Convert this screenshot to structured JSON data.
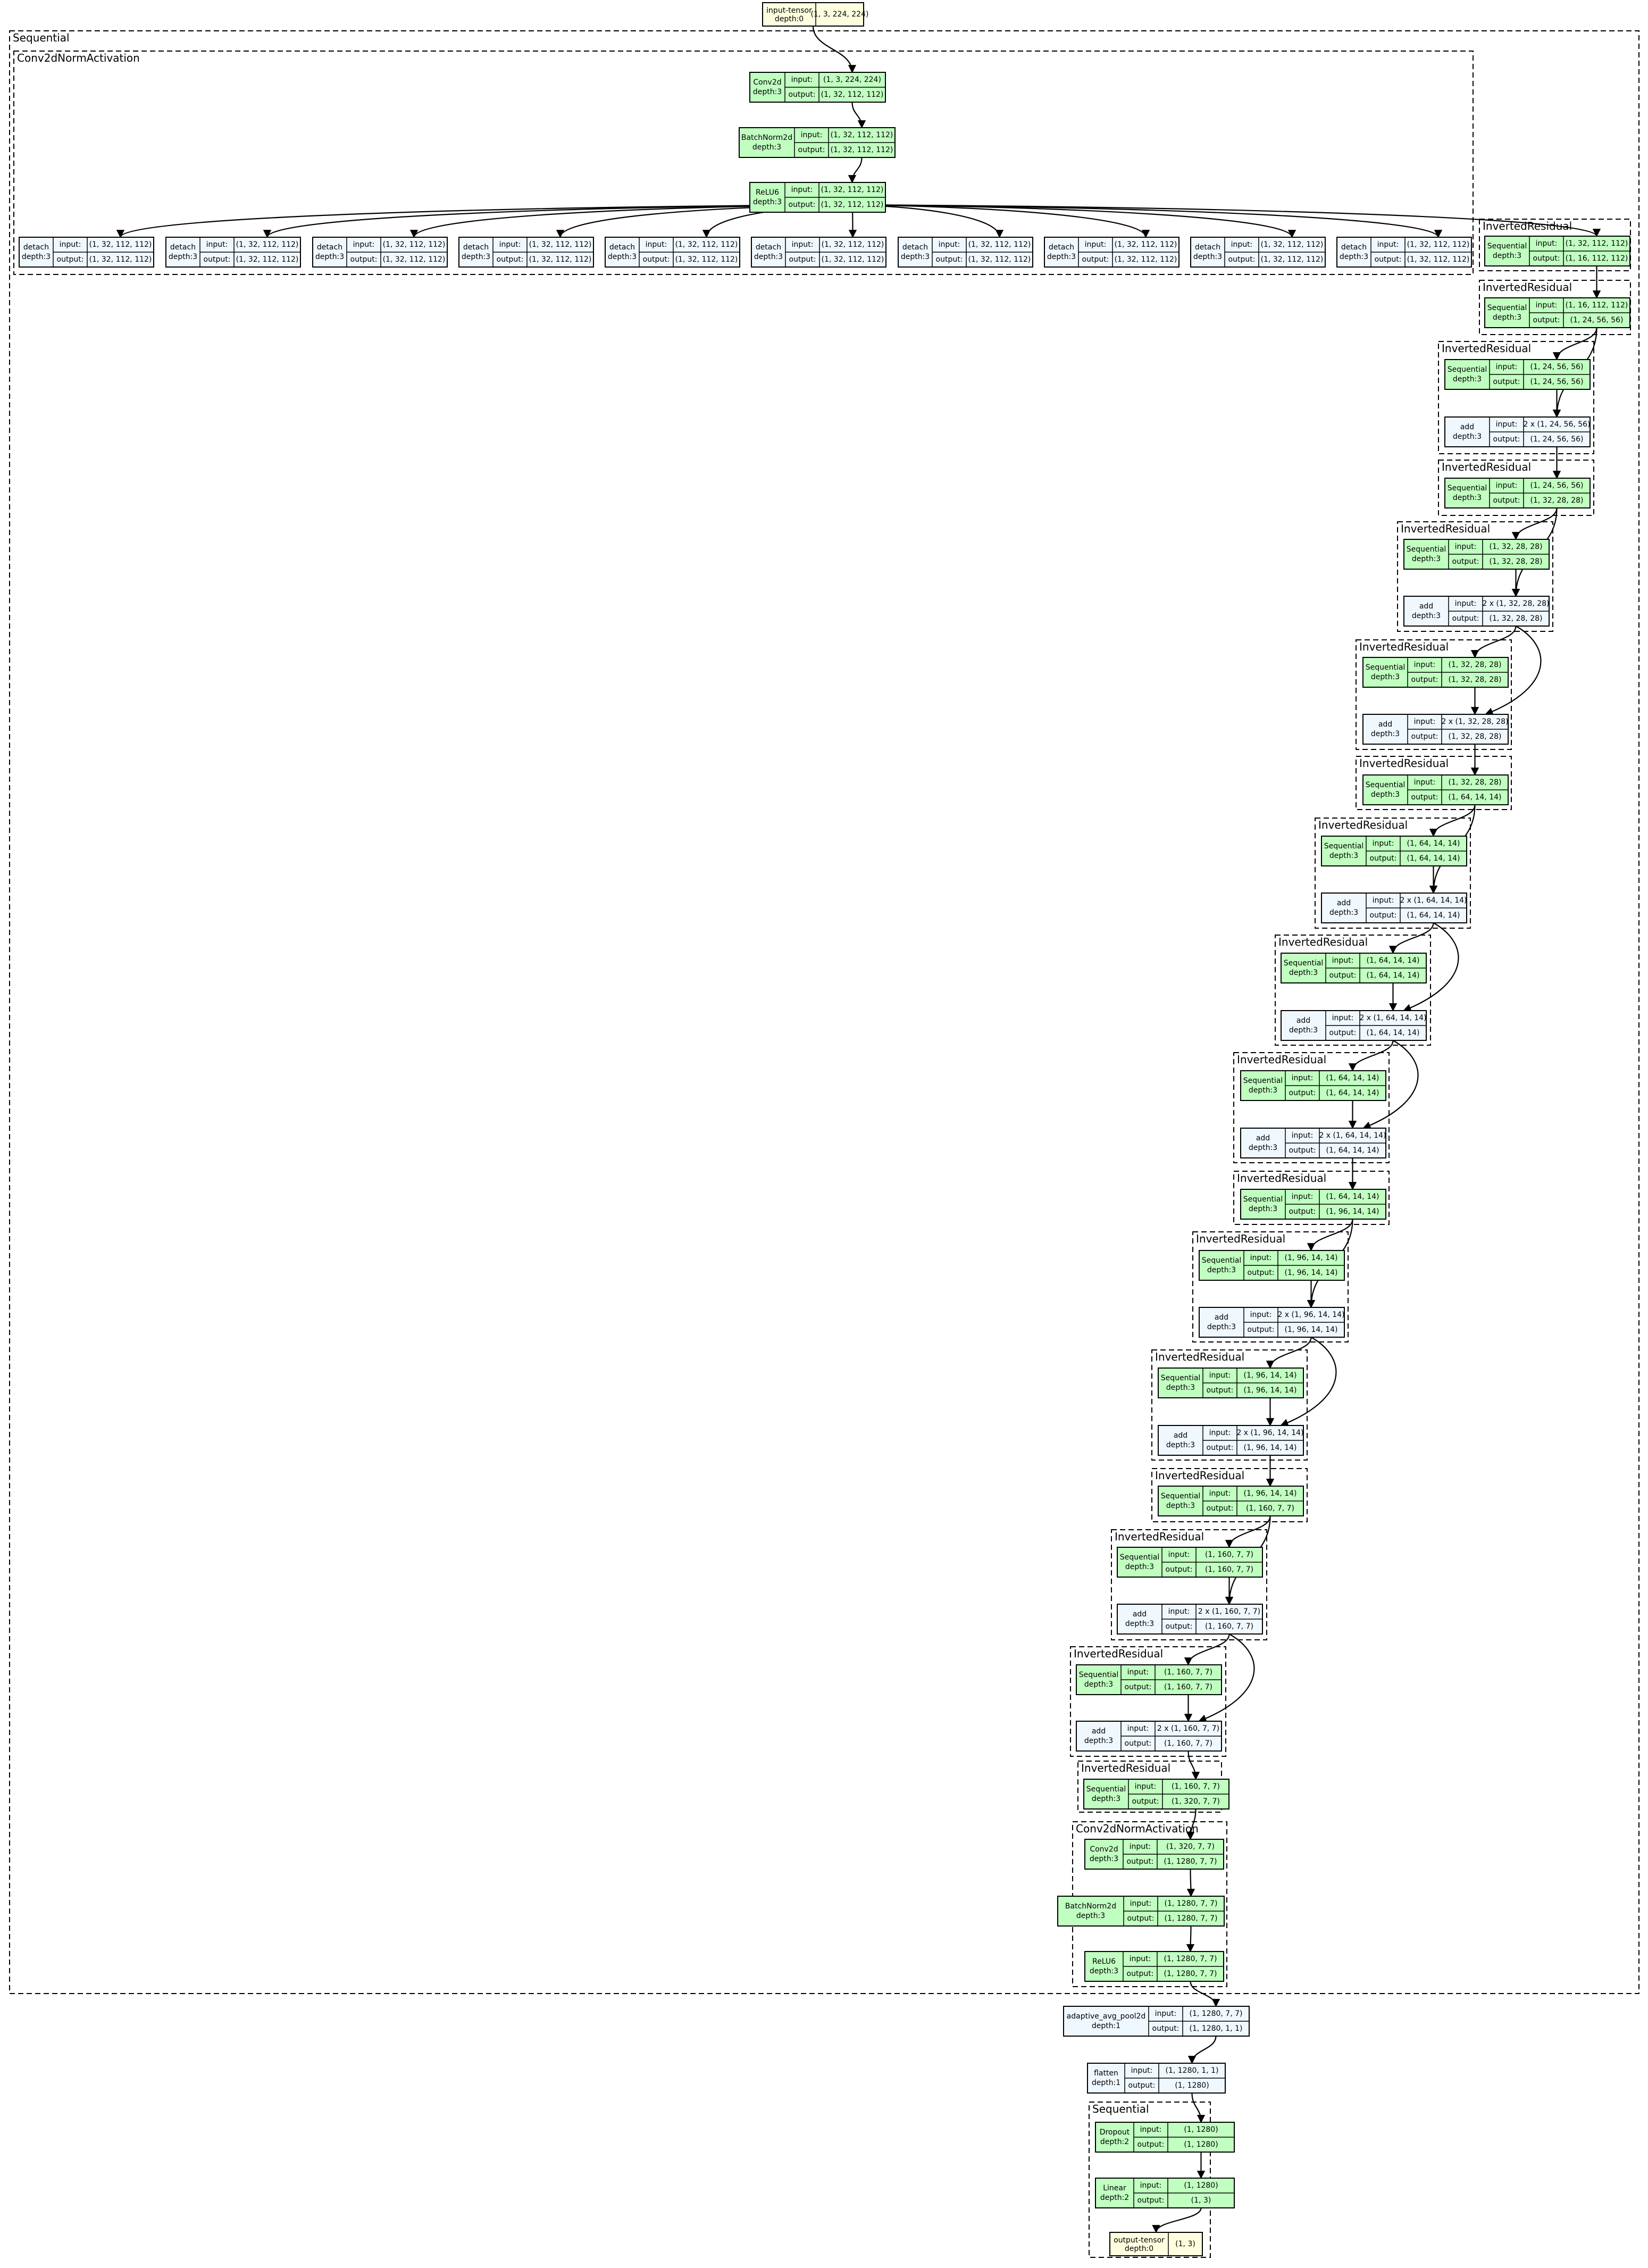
{
  "colors": {
    "tensor_fill": "#ffffe0",
    "module_fill": "#c1ffc1",
    "function_fill": "#f0f8ff",
    "stroke": "#000000",
    "edge": "#000000"
  },
  "labels": {
    "input": "input:",
    "output": "output:"
  },
  "clusters": [
    {
      "id": "c-seq1",
      "label": "Sequential"
    },
    {
      "id": "c-cna1",
      "label": "Conv2dNormActivation"
    },
    {
      "id": "c-ir1",
      "label": "InvertedResidual"
    },
    {
      "id": "c-ir2",
      "label": "InvertedResidual"
    },
    {
      "id": "c-ir3",
      "label": "InvertedResidual"
    },
    {
      "id": "c-ir4",
      "label": "InvertedResidual"
    },
    {
      "id": "c-ir5",
      "label": "InvertedResidual"
    },
    {
      "id": "c-ir6",
      "label": "InvertedResidual"
    },
    {
      "id": "c-ir7",
      "label": "InvertedResidual"
    },
    {
      "id": "c-ir8",
      "label": "InvertedResidual"
    },
    {
      "id": "c-ir9",
      "label": "InvertedResidual"
    },
    {
      "id": "c-ir10",
      "label": "InvertedResidual"
    },
    {
      "id": "c-ir11",
      "label": "InvertedResidual"
    },
    {
      "id": "c-ir12",
      "label": "InvertedResidual"
    },
    {
      "id": "c-ir13",
      "label": "InvertedResidual"
    },
    {
      "id": "c-ir14",
      "label": "InvertedResidual"
    },
    {
      "id": "c-ir15",
      "label": "InvertedResidual"
    },
    {
      "id": "c-ir16",
      "label": "InvertedResidual"
    },
    {
      "id": "c-ir17",
      "label": "InvertedResidual"
    },
    {
      "id": "c-cna2",
      "label": "Conv2dNormActivation"
    },
    {
      "id": "c-seq2",
      "label": "Sequential"
    }
  ],
  "nodes": [
    {
      "id": "in",
      "kind": "tensor",
      "name": "input-tensor",
      "depth": "depth:0",
      "value": "(1, 3, 224, 224)"
    },
    {
      "id": "conv1",
      "kind": "module",
      "name": "Conv2d",
      "depth": "depth:3",
      "input": "(1, 3, 224, 224)",
      "output": "(1, 32, 112, 112)"
    },
    {
      "id": "bn1",
      "kind": "module",
      "name": "BatchNorm2d",
      "depth": "depth:3",
      "input": "(1, 32, 112, 112)",
      "output": "(1, 32, 112, 112)"
    },
    {
      "id": "relu1",
      "kind": "module",
      "name": "ReLU6",
      "depth": "depth:3",
      "input": "(1, 32, 112, 112)",
      "output": "(1, 32, 112, 112)"
    },
    {
      "id": "d1",
      "kind": "function",
      "name": "detach",
      "depth": "depth:3",
      "input": "(1, 32, 112, 112)",
      "output": "(1, 32, 112, 112)"
    },
    {
      "id": "d2",
      "kind": "function",
      "name": "detach",
      "depth": "depth:3",
      "input": "(1, 32, 112, 112)",
      "output": "(1, 32, 112, 112)"
    },
    {
      "id": "d3",
      "kind": "function",
      "name": "detach",
      "depth": "depth:3",
      "input": "(1, 32, 112, 112)",
      "output": "(1, 32, 112, 112)"
    },
    {
      "id": "d4",
      "kind": "function",
      "name": "detach",
      "depth": "depth:3",
      "input": "(1, 32, 112, 112)",
      "output": "(1, 32, 112, 112)"
    },
    {
      "id": "d5",
      "kind": "function",
      "name": "detach",
      "depth": "depth:3",
      "input": "(1, 32, 112, 112)",
      "output": "(1, 32, 112, 112)"
    },
    {
      "id": "d6",
      "kind": "function",
      "name": "detach",
      "depth": "depth:3",
      "input": "(1, 32, 112, 112)",
      "output": "(1, 32, 112, 112)"
    },
    {
      "id": "d7",
      "kind": "function",
      "name": "detach",
      "depth": "depth:3",
      "input": "(1, 32, 112, 112)",
      "output": "(1, 32, 112, 112)"
    },
    {
      "id": "d8",
      "kind": "function",
      "name": "detach",
      "depth": "depth:3",
      "input": "(1, 32, 112, 112)",
      "output": "(1, 32, 112, 112)"
    },
    {
      "id": "d9",
      "kind": "function",
      "name": "detach",
      "depth": "depth:3",
      "input": "(1, 32, 112, 112)",
      "output": "(1, 32, 112, 112)"
    },
    {
      "id": "d10",
      "kind": "function",
      "name": "detach",
      "depth": "depth:3",
      "input": "(1, 32, 112, 112)",
      "output": "(1, 32, 112, 112)"
    },
    {
      "id": "s1",
      "kind": "module",
      "name": "Sequential",
      "depth": "depth:3",
      "input": "(1, 32, 112, 112)",
      "output": "(1, 16, 112, 112)"
    },
    {
      "id": "s2",
      "kind": "module",
      "name": "Sequential",
      "depth": "depth:3",
      "input": "(1, 16, 112, 112)",
      "output": "(1, 24, 56, 56)"
    },
    {
      "id": "s3",
      "kind": "module",
      "name": "Sequential",
      "depth": "depth:3",
      "input": "(1, 24, 56, 56)",
      "output": "(1, 24, 56, 56)"
    },
    {
      "id": "a3",
      "kind": "function",
      "name": "add",
      "depth": "depth:3",
      "input": "2 x (1, 24, 56, 56)",
      "output": "(1, 24, 56, 56)"
    },
    {
      "id": "s4",
      "kind": "module",
      "name": "Sequential",
      "depth": "depth:3",
      "input": "(1, 24, 56, 56)",
      "output": "(1, 32, 28, 28)"
    },
    {
      "id": "s5",
      "kind": "module",
      "name": "Sequential",
      "depth": "depth:3",
      "input": "(1, 32, 28, 28)",
      "output": "(1, 32, 28, 28)"
    },
    {
      "id": "a5",
      "kind": "function",
      "name": "add",
      "depth": "depth:3",
      "input": "2 x (1, 32, 28, 28)",
      "output": "(1, 32, 28, 28)"
    },
    {
      "id": "s6",
      "kind": "module",
      "name": "Sequential",
      "depth": "depth:3",
      "input": "(1, 32, 28, 28)",
      "output": "(1, 32, 28, 28)"
    },
    {
      "id": "a6",
      "kind": "function",
      "name": "add",
      "depth": "depth:3",
      "input": "2 x (1, 32, 28, 28)",
      "output": "(1, 32, 28, 28)"
    },
    {
      "id": "s7",
      "kind": "module",
      "name": "Sequential",
      "depth": "depth:3",
      "input": "(1, 32, 28, 28)",
      "output": "(1, 64, 14, 14)"
    },
    {
      "id": "s8",
      "kind": "module",
      "name": "Sequential",
      "depth": "depth:3",
      "input": "(1, 64, 14, 14)",
      "output": "(1, 64, 14, 14)"
    },
    {
      "id": "a8",
      "kind": "function",
      "name": "add",
      "depth": "depth:3",
      "input": "2 x (1, 64, 14, 14)",
      "output": "(1, 64, 14, 14)"
    },
    {
      "id": "s9",
      "kind": "module",
      "name": "Sequential",
      "depth": "depth:3",
      "input": "(1, 64, 14, 14)",
      "output": "(1, 64, 14, 14)"
    },
    {
      "id": "a9",
      "kind": "function",
      "name": "add",
      "depth": "depth:3",
      "input": "2 x (1, 64, 14, 14)",
      "output": "(1, 64, 14, 14)"
    },
    {
      "id": "s10",
      "kind": "module",
      "name": "Sequential",
      "depth": "depth:3",
      "input": "(1, 64, 14, 14)",
      "output": "(1, 64, 14, 14)"
    },
    {
      "id": "a10",
      "kind": "function",
      "name": "add",
      "depth": "depth:3",
      "input": "2 x (1, 64, 14, 14)",
      "output": "(1, 64, 14, 14)"
    },
    {
      "id": "s11",
      "kind": "module",
      "name": "Sequential",
      "depth": "depth:3",
      "input": "(1, 64, 14, 14)",
      "output": "(1, 96, 14, 14)"
    },
    {
      "id": "s12",
      "kind": "module",
      "name": "Sequential",
      "depth": "depth:3",
      "input": "(1, 96, 14, 14)",
      "output": "(1, 96, 14, 14)"
    },
    {
      "id": "a12",
      "kind": "function",
      "name": "add",
      "depth": "depth:3",
      "input": "2 x (1, 96, 14, 14)",
      "output": "(1, 96, 14, 14)"
    },
    {
      "id": "s13",
      "kind": "module",
      "name": "Sequential",
      "depth": "depth:3",
      "input": "(1, 96, 14, 14)",
      "output": "(1, 96, 14, 14)"
    },
    {
      "id": "a13",
      "kind": "function",
      "name": "add",
      "depth": "depth:3",
      "input": "2 x (1, 96, 14, 14)",
      "output": "(1, 96, 14, 14)"
    },
    {
      "id": "s14",
      "kind": "module",
      "name": "Sequential",
      "depth": "depth:3",
      "input": "(1, 96, 14, 14)",
      "output": "(1, 160, 7, 7)"
    },
    {
      "id": "s15",
      "kind": "module",
      "name": "Sequential",
      "depth": "depth:3",
      "input": "(1, 160, 7, 7)",
      "output": "(1, 160, 7, 7)"
    },
    {
      "id": "a15",
      "kind": "function",
      "name": "add",
      "depth": "depth:3",
      "input": "2 x (1, 160, 7, 7)",
      "output": "(1, 160, 7, 7)"
    },
    {
      "id": "s16",
      "kind": "module",
      "name": "Sequential",
      "depth": "depth:3",
      "input": "(1, 160, 7, 7)",
      "output": "(1, 160, 7, 7)"
    },
    {
      "id": "a16",
      "kind": "function",
      "name": "add",
      "depth": "depth:3",
      "input": "2 x (1, 160, 7, 7)",
      "output": "(1, 160, 7, 7)"
    },
    {
      "id": "s17",
      "kind": "module",
      "name": "Sequential",
      "depth": "depth:3",
      "input": "(1, 160, 7, 7)",
      "output": "(1, 320, 7, 7)"
    },
    {
      "id": "conv2",
      "kind": "module",
      "name": "Conv2d",
      "depth": "depth:3",
      "input": "(1, 320, 7, 7)",
      "output": "(1, 1280, 7, 7)"
    },
    {
      "id": "bn2",
      "kind": "module",
      "name": "BatchNorm2d",
      "depth": "depth:3",
      "input": "(1, 1280, 7, 7)",
      "output": "(1, 1280, 7, 7)"
    },
    {
      "id": "relu2",
      "kind": "module",
      "name": "ReLU6",
      "depth": "depth:3",
      "input": "(1, 1280, 7, 7)",
      "output": "(1, 1280, 7, 7)"
    },
    {
      "id": "pool",
      "kind": "function",
      "name": "adaptive_avg_pool2d",
      "depth": "depth:1",
      "input": "(1, 1280, 7, 7)",
      "output": "(1, 1280, 1, 1)"
    },
    {
      "id": "flat",
      "kind": "function",
      "name": "flatten",
      "depth": "depth:1",
      "input": "(1, 1280, 1, 1)",
      "output": "(1, 1280)"
    },
    {
      "id": "drop",
      "kind": "module",
      "name": "Dropout",
      "depth": "depth:2",
      "input": "(1, 1280)",
      "output": "(1, 1280)"
    },
    {
      "id": "lin",
      "kind": "module",
      "name": "Linear",
      "depth": "depth:2",
      "input": "(1, 1280)",
      "output": "(1, 3)"
    },
    {
      "id": "out",
      "kind": "tensor",
      "name": "output-tensor",
      "depth": "depth:0",
      "value": "(1, 3)"
    }
  ],
  "edges": [
    [
      "in",
      "conv1"
    ],
    [
      "conv1",
      "bn1"
    ],
    [
      "bn1",
      "relu1"
    ],
    [
      "relu1",
      "d1"
    ],
    [
      "relu1",
      "d2"
    ],
    [
      "relu1",
      "d3"
    ],
    [
      "relu1",
      "d4"
    ],
    [
      "relu1",
      "d5"
    ],
    [
      "relu1",
      "d6"
    ],
    [
      "relu1",
      "d7"
    ],
    [
      "relu1",
      "d8"
    ],
    [
      "relu1",
      "d9"
    ],
    [
      "relu1",
      "d10"
    ],
    [
      "relu1",
      "s1"
    ],
    [
      "s1",
      "s2"
    ],
    [
      "s2",
      "s3"
    ],
    [
      "s2",
      "a3"
    ],
    [
      "s3",
      "a3"
    ],
    [
      "a3",
      "s4"
    ],
    [
      "s4",
      "s5"
    ],
    [
      "s4",
      "a5"
    ],
    [
      "s5",
      "a5"
    ],
    [
      "a5",
      "s6"
    ],
    [
      "a5",
      "a6"
    ],
    [
      "s6",
      "a6"
    ],
    [
      "a6",
      "s7"
    ],
    [
      "s7",
      "s8"
    ],
    [
      "s7",
      "a8"
    ],
    [
      "s8",
      "a8"
    ],
    [
      "a8",
      "s9"
    ],
    [
      "a8",
      "a9"
    ],
    [
      "s9",
      "a9"
    ],
    [
      "a9",
      "s10"
    ],
    [
      "a9",
      "a10"
    ],
    [
      "s10",
      "a10"
    ],
    [
      "a10",
      "s11"
    ],
    [
      "s11",
      "s12"
    ],
    [
      "s11",
      "a12"
    ],
    [
      "s12",
      "a12"
    ],
    [
      "a12",
      "s13"
    ],
    [
      "a12",
      "a13"
    ],
    [
      "s13",
      "a13"
    ],
    [
      "a13",
      "s14"
    ],
    [
      "s14",
      "s15"
    ],
    [
      "s14",
      "a15"
    ],
    [
      "s15",
      "a15"
    ],
    [
      "a15",
      "s16"
    ],
    [
      "a15",
      "a16"
    ],
    [
      "s16",
      "a16"
    ],
    [
      "a16",
      "s17"
    ],
    [
      "s17",
      "conv2"
    ],
    [
      "conv2",
      "bn2"
    ],
    [
      "bn2",
      "relu2"
    ],
    [
      "relu2",
      "pool"
    ],
    [
      "pool",
      "flat"
    ],
    [
      "flat",
      "drop"
    ],
    [
      "drop",
      "lin"
    ],
    [
      "lin",
      "out"
    ]
  ]
}
